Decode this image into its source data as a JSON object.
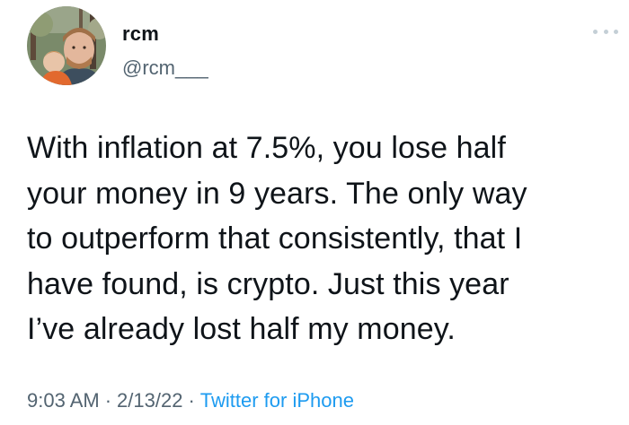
{
  "author": {
    "name": "rcm",
    "handle": "@rcm___"
  },
  "more_icon": "ellipsis-icon",
  "tweet": {
    "lines": [
      "With inflation at 7.5%, you lose half",
      "your money in 9 years. The only way",
      "to outperform that consistently, that I",
      "have found, is crypto. Just this year",
      "I’ve already lost half my money."
    ]
  },
  "meta": {
    "time": "9:03 AM",
    "separator": "·",
    "date": "2/13/22",
    "source": "Twitter for iPhone"
  },
  "colors": {
    "text": "#0f1419",
    "secondary": "#536471",
    "link": "#1d9bf0"
  }
}
